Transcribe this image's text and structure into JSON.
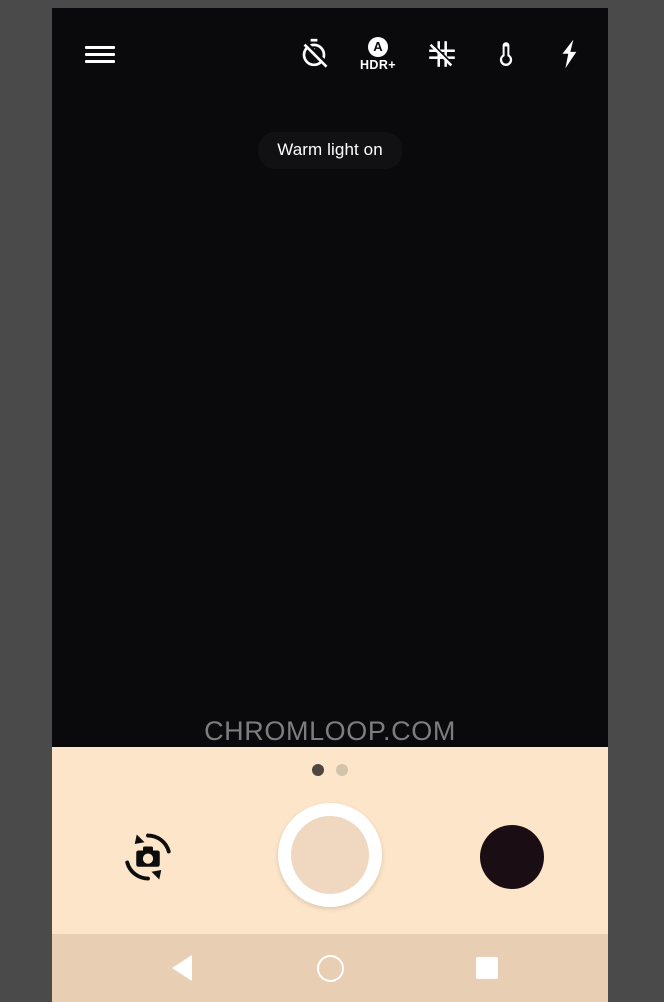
{
  "app": {
    "name": "Camera",
    "frame_background": "#4a4a4a",
    "viewfinder_background": "#0a0a0c"
  },
  "topbar": {
    "menu": {
      "label": "Menu",
      "icon": "hamburger-menu-icon"
    },
    "timer": {
      "label": "Timer off",
      "icon": "timer-off-icon"
    },
    "hdr": {
      "label": "HDR+",
      "mode": "A",
      "icon": "hdr-plus-auto-icon"
    },
    "grid": {
      "label": "Grid off",
      "icon": "grid-off-icon"
    },
    "temperature": {
      "label": "Warm light",
      "icon": "thermometer-icon"
    },
    "flash": {
      "label": "Flash",
      "icon": "flash-icon"
    }
  },
  "toast": {
    "message": "Warm light on"
  },
  "watermark": {
    "text": "CHROMLOOP.COM",
    "color": "#7d7d7d"
  },
  "controls": {
    "background": "#fce5c8",
    "pager": {
      "count": 2,
      "active_index": 0,
      "active_color": "#4e453e",
      "inactive_color": "#d3c3ab"
    },
    "flip_camera": {
      "label": "Switch camera",
      "icon": "camera-flip-icon"
    },
    "shutter": {
      "label": "Take photo",
      "icon": "shutter-button-icon",
      "ring_color": "#ffffff",
      "inner_color": "#efd8bf"
    },
    "thumbnail": {
      "label": "Last photo",
      "icon": "gallery-thumbnail-icon",
      "color": "#1a0d14"
    }
  },
  "navbar": {
    "background": "#e8cfb4",
    "back": {
      "label": "Back",
      "icon": "nav-back-icon"
    },
    "home": {
      "label": "Home",
      "icon": "nav-home-icon"
    },
    "recents": {
      "label": "Recents",
      "icon": "nav-recents-icon"
    }
  }
}
